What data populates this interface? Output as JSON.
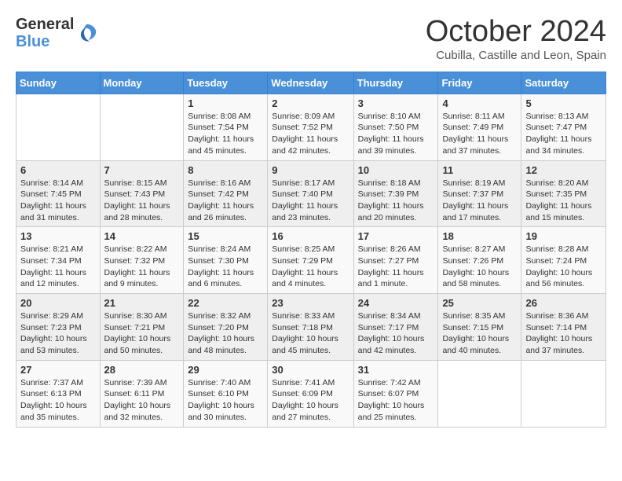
{
  "header": {
    "logo_general": "General",
    "logo_blue": "Blue",
    "month": "October 2024",
    "location": "Cubilla, Castille and Leon, Spain"
  },
  "weekdays": [
    "Sunday",
    "Monday",
    "Tuesday",
    "Wednesday",
    "Thursday",
    "Friday",
    "Saturday"
  ],
  "weeks": [
    [
      {
        "day": "",
        "info": ""
      },
      {
        "day": "",
        "info": ""
      },
      {
        "day": "1",
        "info": "Sunrise: 8:08 AM\nSunset: 7:54 PM\nDaylight: 11 hours and 45 minutes."
      },
      {
        "day": "2",
        "info": "Sunrise: 8:09 AM\nSunset: 7:52 PM\nDaylight: 11 hours and 42 minutes."
      },
      {
        "day": "3",
        "info": "Sunrise: 8:10 AM\nSunset: 7:50 PM\nDaylight: 11 hours and 39 minutes."
      },
      {
        "day": "4",
        "info": "Sunrise: 8:11 AM\nSunset: 7:49 PM\nDaylight: 11 hours and 37 minutes."
      },
      {
        "day": "5",
        "info": "Sunrise: 8:13 AM\nSunset: 7:47 PM\nDaylight: 11 hours and 34 minutes."
      }
    ],
    [
      {
        "day": "6",
        "info": "Sunrise: 8:14 AM\nSunset: 7:45 PM\nDaylight: 11 hours and 31 minutes."
      },
      {
        "day": "7",
        "info": "Sunrise: 8:15 AM\nSunset: 7:43 PM\nDaylight: 11 hours and 28 minutes."
      },
      {
        "day": "8",
        "info": "Sunrise: 8:16 AM\nSunset: 7:42 PM\nDaylight: 11 hours and 26 minutes."
      },
      {
        "day": "9",
        "info": "Sunrise: 8:17 AM\nSunset: 7:40 PM\nDaylight: 11 hours and 23 minutes."
      },
      {
        "day": "10",
        "info": "Sunrise: 8:18 AM\nSunset: 7:39 PM\nDaylight: 11 hours and 20 minutes."
      },
      {
        "day": "11",
        "info": "Sunrise: 8:19 AM\nSunset: 7:37 PM\nDaylight: 11 hours and 17 minutes."
      },
      {
        "day": "12",
        "info": "Sunrise: 8:20 AM\nSunset: 7:35 PM\nDaylight: 11 hours and 15 minutes."
      }
    ],
    [
      {
        "day": "13",
        "info": "Sunrise: 8:21 AM\nSunset: 7:34 PM\nDaylight: 11 hours and 12 minutes."
      },
      {
        "day": "14",
        "info": "Sunrise: 8:22 AM\nSunset: 7:32 PM\nDaylight: 11 hours and 9 minutes."
      },
      {
        "day": "15",
        "info": "Sunrise: 8:24 AM\nSunset: 7:30 PM\nDaylight: 11 hours and 6 minutes."
      },
      {
        "day": "16",
        "info": "Sunrise: 8:25 AM\nSunset: 7:29 PM\nDaylight: 11 hours and 4 minutes."
      },
      {
        "day": "17",
        "info": "Sunrise: 8:26 AM\nSunset: 7:27 PM\nDaylight: 11 hours and 1 minute."
      },
      {
        "day": "18",
        "info": "Sunrise: 8:27 AM\nSunset: 7:26 PM\nDaylight: 10 hours and 58 minutes."
      },
      {
        "day": "19",
        "info": "Sunrise: 8:28 AM\nSunset: 7:24 PM\nDaylight: 10 hours and 56 minutes."
      }
    ],
    [
      {
        "day": "20",
        "info": "Sunrise: 8:29 AM\nSunset: 7:23 PM\nDaylight: 10 hours and 53 minutes."
      },
      {
        "day": "21",
        "info": "Sunrise: 8:30 AM\nSunset: 7:21 PM\nDaylight: 10 hours and 50 minutes."
      },
      {
        "day": "22",
        "info": "Sunrise: 8:32 AM\nSunset: 7:20 PM\nDaylight: 10 hours and 48 minutes."
      },
      {
        "day": "23",
        "info": "Sunrise: 8:33 AM\nSunset: 7:18 PM\nDaylight: 10 hours and 45 minutes."
      },
      {
        "day": "24",
        "info": "Sunrise: 8:34 AM\nSunset: 7:17 PM\nDaylight: 10 hours and 42 minutes."
      },
      {
        "day": "25",
        "info": "Sunrise: 8:35 AM\nSunset: 7:15 PM\nDaylight: 10 hours and 40 minutes."
      },
      {
        "day": "26",
        "info": "Sunrise: 8:36 AM\nSunset: 7:14 PM\nDaylight: 10 hours and 37 minutes."
      }
    ],
    [
      {
        "day": "27",
        "info": "Sunrise: 7:37 AM\nSunset: 6:13 PM\nDaylight: 10 hours and 35 minutes."
      },
      {
        "day": "28",
        "info": "Sunrise: 7:39 AM\nSunset: 6:11 PM\nDaylight: 10 hours and 32 minutes."
      },
      {
        "day": "29",
        "info": "Sunrise: 7:40 AM\nSunset: 6:10 PM\nDaylight: 10 hours and 30 minutes."
      },
      {
        "day": "30",
        "info": "Sunrise: 7:41 AM\nSunset: 6:09 PM\nDaylight: 10 hours and 27 minutes."
      },
      {
        "day": "31",
        "info": "Sunrise: 7:42 AM\nSunset: 6:07 PM\nDaylight: 10 hours and 25 minutes."
      },
      {
        "day": "",
        "info": ""
      },
      {
        "day": "",
        "info": ""
      }
    ]
  ]
}
